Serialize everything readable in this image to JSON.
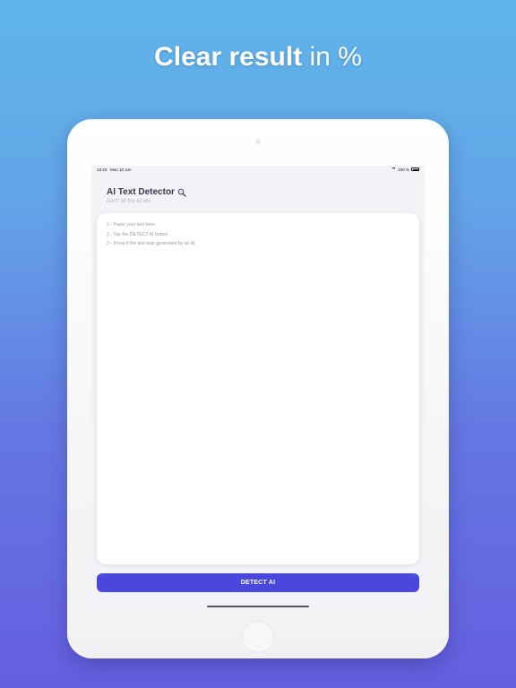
{
  "headline": {
    "strong": "Clear result",
    "light": " in %"
  },
  "status_bar": {
    "time": "13:23",
    "date": "Mon 10 Jun",
    "battery": "100 %"
  },
  "app": {
    "title": "AI Text Detector",
    "subtitle": "Don't let the AI win",
    "title_icon": "magnifier-icon"
  },
  "instructions": [
    "1 - Paste your text here",
    "2 - Tap the DETECT AI button",
    "3 - Know if the text was generated by an AI"
  ],
  "detect_button": {
    "label": "DETECT AI"
  },
  "colors": {
    "accent": "#4a47dc",
    "background_top": "#5fb4ea",
    "background_bottom": "#655ee0"
  }
}
